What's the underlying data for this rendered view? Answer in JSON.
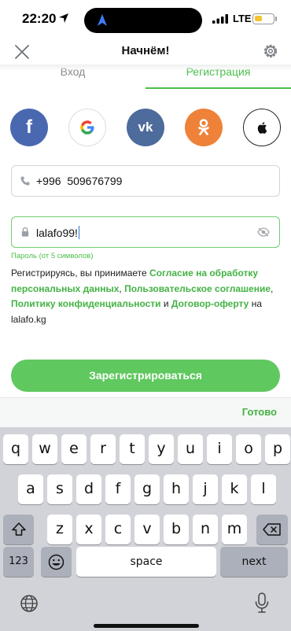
{
  "status": {
    "time": "22:20",
    "network": "LTE",
    "battery_level": 0.45
  },
  "header": {
    "title": "Начнём!"
  },
  "tabs": [
    {
      "label": "Вход"
    },
    {
      "label": "Регистрация"
    }
  ],
  "social": {
    "facebook": "f",
    "vk": "vk"
  },
  "phone_field": {
    "value": "+996  509676799"
  },
  "password_field": {
    "value": "lalafo99!",
    "hint": "Пароль (от 5 символов)"
  },
  "legal": {
    "p1": "Регистрируясь, вы принимаете ",
    "l1": "Согласие на обработку персональных данных",
    "p2": ", ",
    "l2": "Пользовательское соглашение",
    "p3": ", ",
    "l3": "Политику конфиденциальности",
    "p4": " и ",
    "l4": "Договор-оферту",
    "p5": " на lalafo.kg"
  },
  "register_button": {
    "label": "Зарегистрироваться"
  },
  "keyboard": {
    "done_label": "Готово",
    "row1": [
      "q",
      "w",
      "e",
      "r",
      "t",
      "y",
      "u",
      "i",
      "o",
      "p"
    ],
    "row2": [
      "a",
      "s",
      "d",
      "f",
      "g",
      "h",
      "j",
      "k",
      "l"
    ],
    "row3": [
      "z",
      "x",
      "c",
      "v",
      "b",
      "n",
      "m"
    ],
    "numbers_key": "123",
    "space_key": "space",
    "next_key": "next"
  },
  "icons": {
    "close": "close-icon",
    "settings": "gear-icon",
    "phone": "phone-icon",
    "lock": "lock-icon",
    "eye": "eye-icon",
    "google": "google-icon",
    "odnoklassniki": "odnoklassniki-icon",
    "apple": "apple-icon",
    "shift": "shift-icon",
    "backspace": "backspace-icon",
    "emoji": "emoji-icon",
    "globe": "globe-icon",
    "mic": "microphone-icon"
  },
  "colors": {
    "accent": "#4bbf4b",
    "button": "#5fc85f",
    "facebook": "#4a68b0",
    "vk": "#4d6b9b",
    "ok": "#ee8238"
  }
}
